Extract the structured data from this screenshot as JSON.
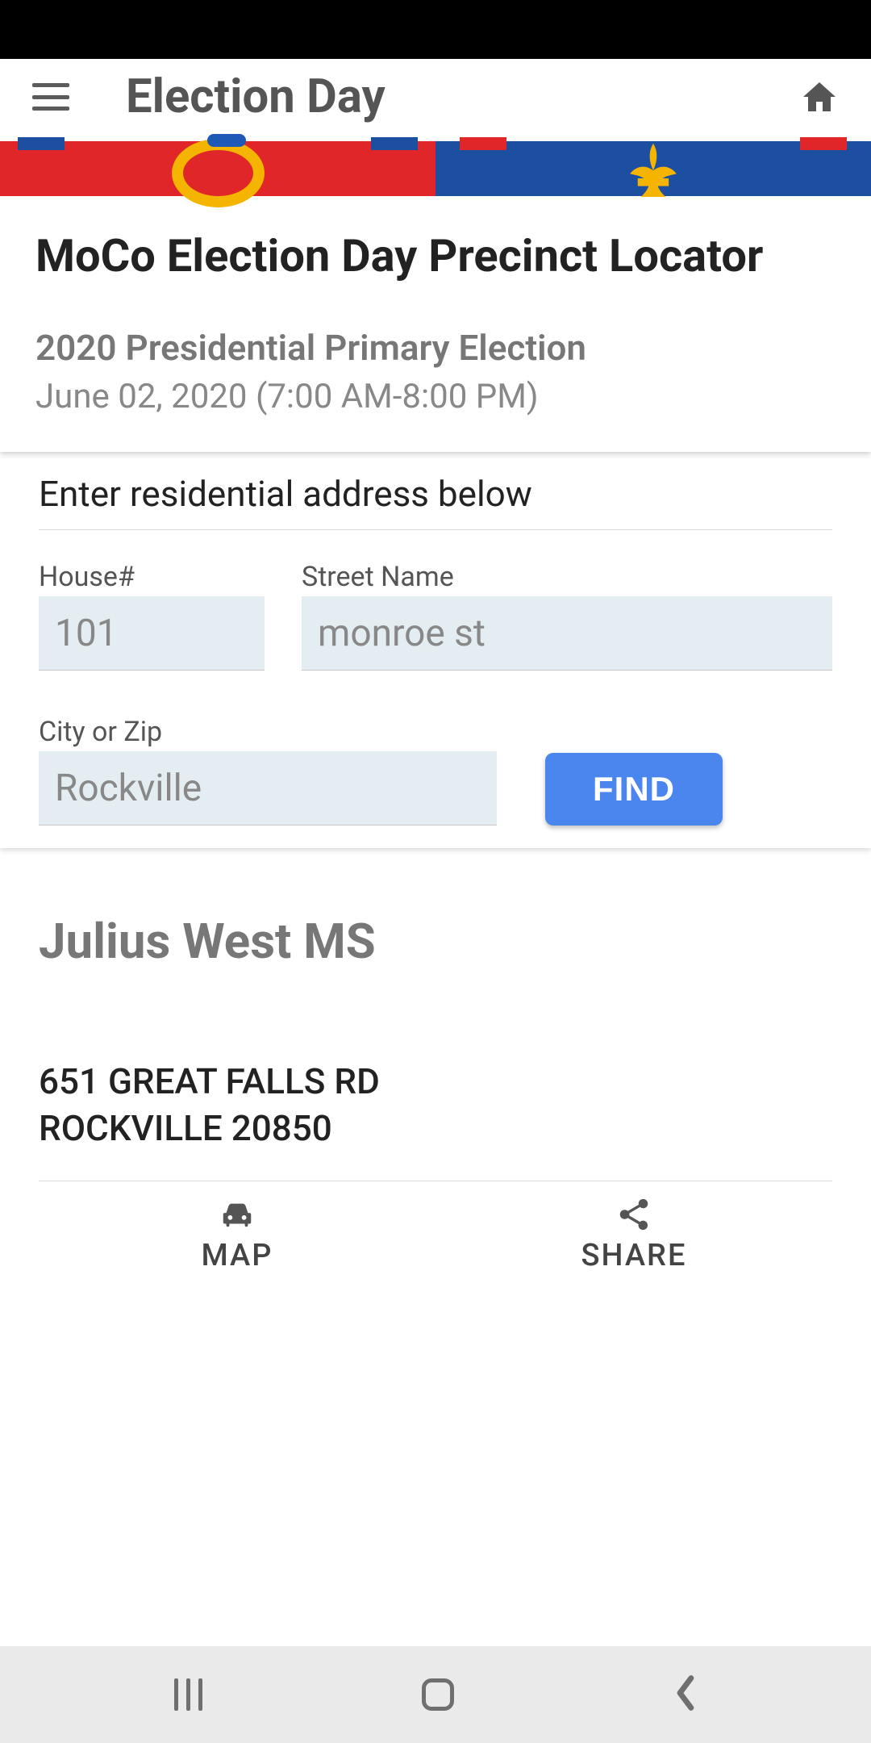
{
  "appbar": {
    "title": "Election Day"
  },
  "header": {
    "title": "MoCo Election Day Precinct Locator",
    "subtitle": "2020 Presidential Primary Election",
    "datetime": "June 02, 2020 (7:00 AM-8:00 PM)"
  },
  "form": {
    "heading": "Enter residential address below",
    "house_label": "House#",
    "house_value": "101",
    "street_label": "Street Name",
    "street_value": "monroe st",
    "city_label": "City or Zip",
    "city_value": "Rockville",
    "find_label": "FIND"
  },
  "result": {
    "name": "Julius West MS",
    "address_line1": "651 GREAT FALLS RD",
    "address_line2": "ROCKVILLE 20850"
  },
  "actions": {
    "map_label": "MAP",
    "share_label": "SHARE"
  }
}
